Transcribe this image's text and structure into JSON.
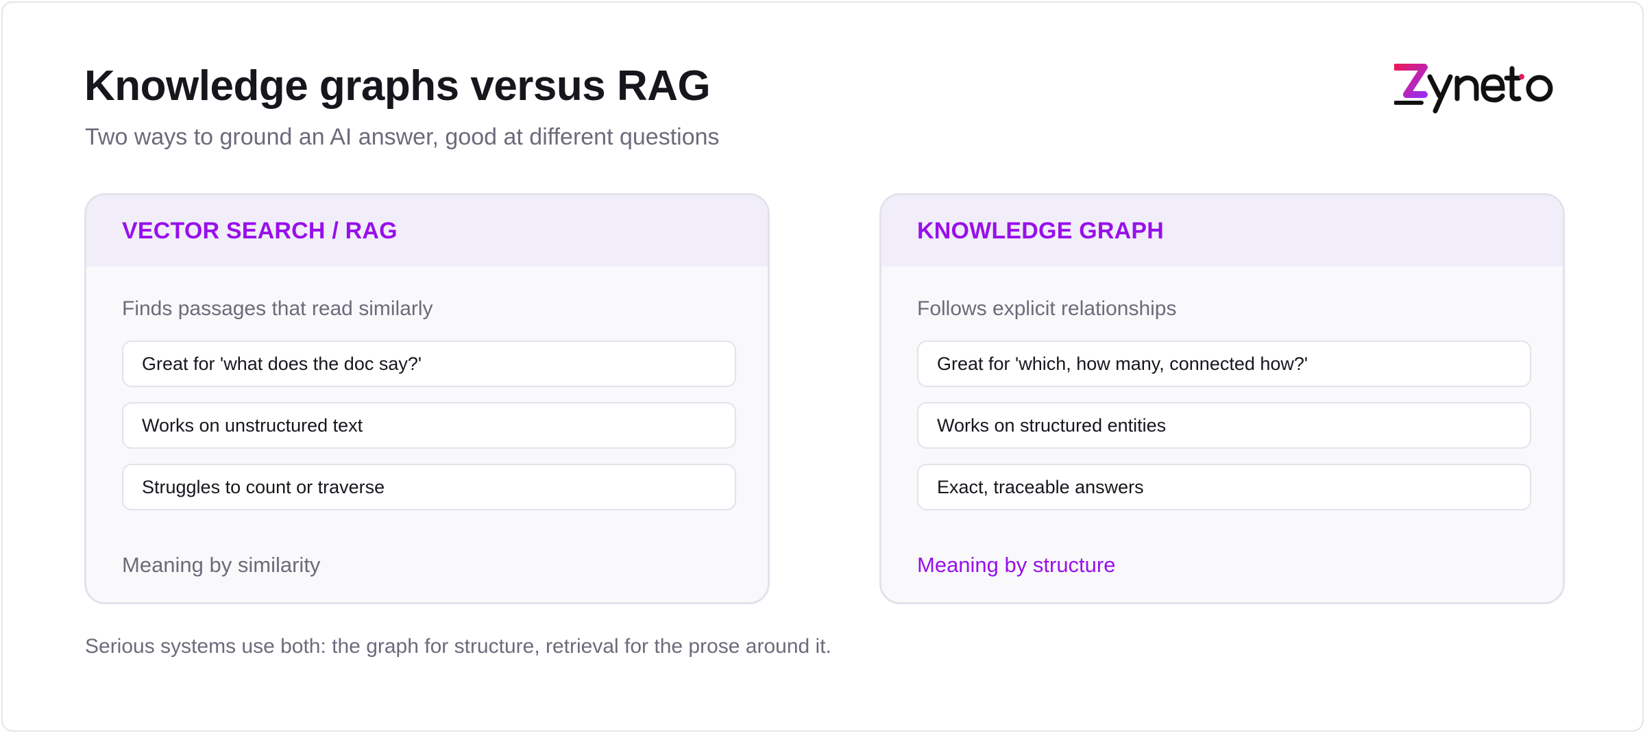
{
  "header": {
    "title": "Knowledge graphs versus RAG",
    "subtitle": "Two ways to ground an AI answer, good at different questions"
  },
  "logo": {
    "text": "zyneto",
    "accent": "#e8195c",
    "accent2": "#9b2cf0"
  },
  "cards": [
    {
      "title": "VECTOR SEARCH / RAG",
      "description": "Finds passages that read similarly",
      "items": [
        "Great for 'what does the doc say?'",
        "Works on unstructured text",
        "Struggles to count or traverse"
      ],
      "footer": "Meaning by similarity"
    },
    {
      "title": "KNOWLEDGE GRAPH",
      "description": "Follows explicit relationships",
      "items": [
        "Great for 'which, how many, connected how?'",
        "Works on structured entities",
        "Exact, traceable answers"
      ],
      "footer": "Meaning by structure"
    }
  ],
  "footnote": "Serious systems use both: the graph for structure, retrieval for the prose around it.",
  "colors": {
    "accent": "#9810ea",
    "card_header_bg": "#f1eefa",
    "card_bg": "#f9f9fb",
    "muted_text": "#6b6b7b",
    "heading_text": "#16161d"
  }
}
